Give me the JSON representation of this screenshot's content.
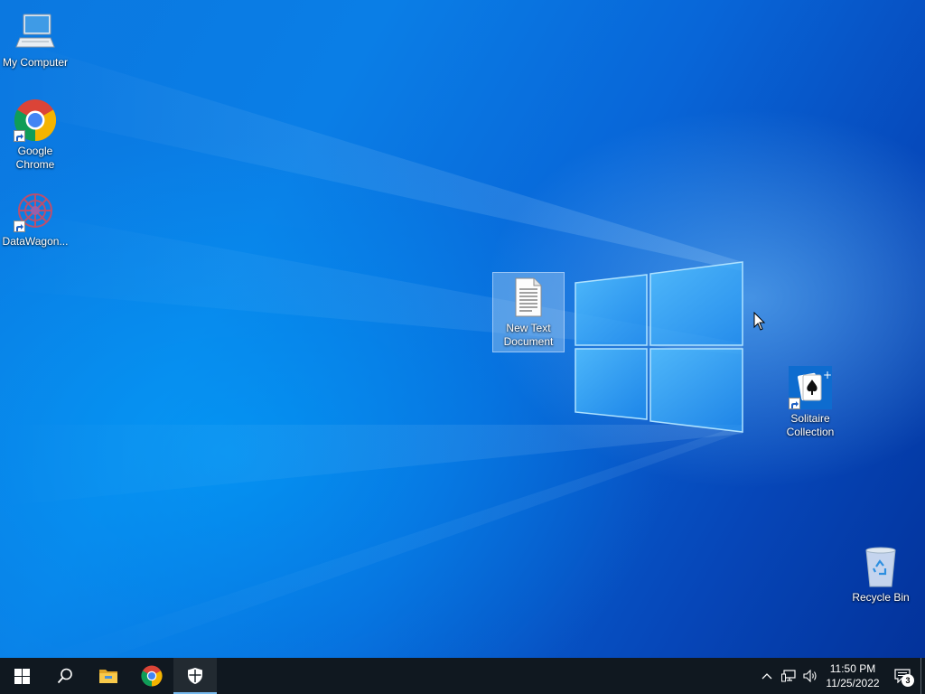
{
  "desktop": {
    "icons": [
      {
        "label": "My Computer",
        "icon": "computer-icon"
      },
      {
        "label": "Google Chrome",
        "icon": "chrome-icon",
        "shortcut": true
      },
      {
        "label": "DataWagon...",
        "icon": "datawagon-icon",
        "shortcut": true
      },
      {
        "label": "New Text Document",
        "icon": "text-document-icon",
        "selected": true
      },
      {
        "label": "Solitaire Collection",
        "icon": "solitaire-icon",
        "shortcut": true
      },
      {
        "label": "Recycle Bin",
        "icon": "recycle-bin-icon"
      }
    ]
  },
  "taskbar": {
    "buttons": [
      {
        "icon": "windows-start-icon"
      },
      {
        "icon": "search-icon"
      },
      {
        "icon": "file-explorer-icon"
      },
      {
        "icon": "chrome-icon"
      },
      {
        "icon": "windows-security-icon",
        "active": true
      }
    ],
    "tray": {
      "icons": [
        "chevron-up-icon",
        "network-icon",
        "volume-icon"
      ],
      "time": "11:50 PM",
      "date": "11/25/2022",
      "notification_count": "3"
    }
  },
  "colors": {
    "taskbar_bg": "#101820",
    "accent": "#76b9ed",
    "wallpaper_blue": "#0a64d8"
  }
}
